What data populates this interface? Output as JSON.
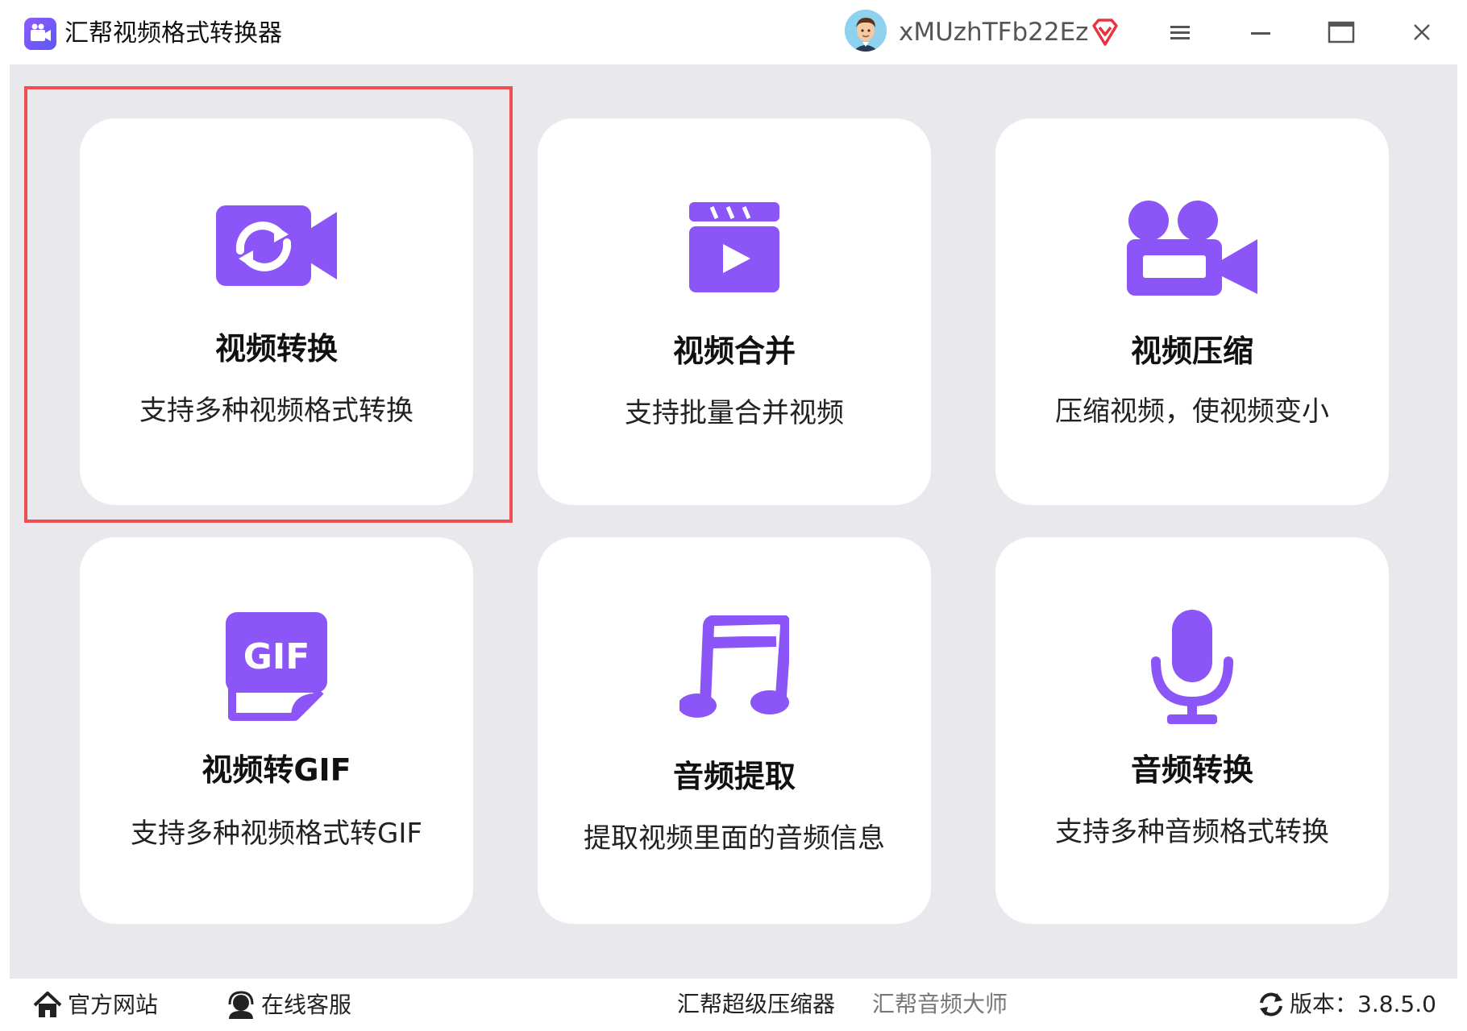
{
  "app": {
    "title": "汇帮视频格式转换器"
  },
  "user": {
    "name": "xMUzhTFb22Ez"
  },
  "colors": {
    "accent": "#8b55f7",
    "highlight": "#ee4f52",
    "background": "#e9e9ed"
  },
  "cards": [
    {
      "title": "视频转换",
      "desc": "支持多种视频格式转换",
      "icon": "video-convert-icon"
    },
    {
      "title": "视频合并",
      "desc": "支持批量合并视频",
      "icon": "video-clapper-icon"
    },
    {
      "title": "视频压缩",
      "desc": "压缩视频，使视频变小",
      "icon": "video-camera-icon"
    },
    {
      "title": "视频转GIF",
      "desc": "支持多种视频格式转GIF",
      "icon": "gif-file-icon"
    },
    {
      "title": "音频提取",
      "desc": "提取视频里面的音频信息",
      "icon": "music-note-icon"
    },
    {
      "title": "音频转换",
      "desc": "支持多种音频格式转换",
      "icon": "microphone-icon"
    }
  ],
  "footer": {
    "website": "官方网站",
    "support": "在线客服",
    "link1": "汇帮超级压缩器",
    "link2": "汇帮音频大师",
    "version": "版本：3.8.5.0"
  }
}
